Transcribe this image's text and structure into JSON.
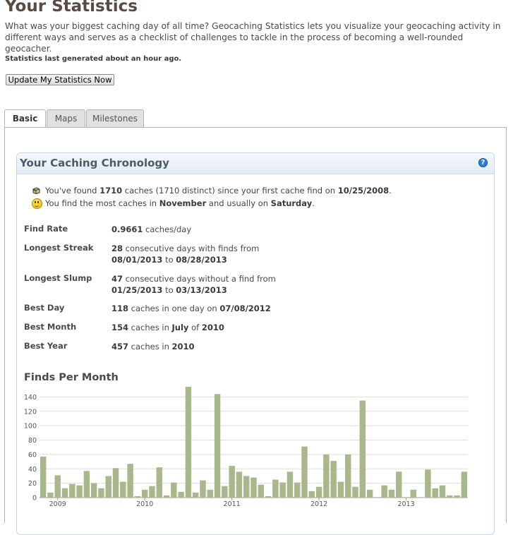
{
  "page": {
    "title": "Your Statistics",
    "intro": "What was your biggest caching day of all time? Geocaching Statistics lets you visualize your geocaching activity in different ways and serves as a checklist of challenges to tackle in the process of becoming a well-rounded geocacher.",
    "generated": "Statistics last generated about an hour ago.",
    "update_button": "Update My Statistics Now"
  },
  "tabs": [
    {
      "label": "Basic",
      "active": true
    },
    {
      "label": "Maps",
      "active": false
    },
    {
      "label": "Milestones",
      "active": false
    }
  ],
  "chronology": {
    "title": "Your Caching Chronology",
    "help_icon": "?",
    "found": {
      "t1": "You've found ",
      "count": "1710",
      "t2": " caches (1710 distinct) since your first cache find on ",
      "date": "10/25/2008",
      "t3": "."
    },
    "most": {
      "t1": "You find the most caches in ",
      "month": "November",
      "t2": " and usually on ",
      "day": "Saturday",
      "t3": "."
    },
    "stats": {
      "find_rate": {
        "label": "Find Rate",
        "value": "0.9661",
        "text": " caches/day"
      },
      "longest_streak": {
        "label": "Longest Streak",
        "value": "28",
        "text": " consecutive days with finds from",
        "from": "08/01/2013",
        "to_word": " to ",
        "to": "08/28/2013"
      },
      "longest_slump": {
        "label": "Longest Slump",
        "value": "47",
        "text": " consecutive days without a find from",
        "from": "01/25/2013",
        "to_word": " to ",
        "to": "03/13/2013"
      },
      "best_day": {
        "label": "Best Day",
        "value": "118",
        "text": " caches in one day on ",
        "date": "07/08/2012"
      },
      "best_month": {
        "label": "Best Month",
        "value": "154",
        "text": " caches in ",
        "month": "July",
        "of": " of ",
        "year": "2010"
      },
      "best_year": {
        "label": "Best Year",
        "value": "457",
        "text": " caches in ",
        "year": "2010"
      }
    }
  },
  "colors": {
    "bar": "#a8b88c",
    "grid": "#dddddd",
    "axis": "#999999"
  },
  "chart_data": {
    "type": "bar",
    "title": "Finds Per Month",
    "ylim": [
      0,
      160
    ],
    "yticks": [
      0,
      20,
      40,
      60,
      80,
      100,
      120,
      140
    ],
    "year_labels": [
      {
        "label": "2009",
        "index": 2
      },
      {
        "label": "2010",
        "index": 14
      },
      {
        "label": "2011",
        "index": 26
      },
      {
        "label": "2012",
        "index": 38
      },
      {
        "label": "2013",
        "index": 50
      }
    ],
    "values": [
      57,
      7,
      31,
      13,
      19,
      17,
      37,
      20,
      13,
      30,
      41,
      22,
      47,
      2,
      11,
      16,
      42,
      3,
      21,
      8,
      154,
      7,
      24,
      11,
      144,
      16,
      44,
      36,
      30,
      28,
      18,
      2,
      25,
      21,
      36,
      21,
      71,
      9,
      15,
      60,
      51,
      22,
      60,
      15,
      135,
      11,
      0,
      17,
      11,
      36,
      0,
      11,
      0,
      39,
      13,
      17,
      3,
      3,
      36
    ]
  }
}
